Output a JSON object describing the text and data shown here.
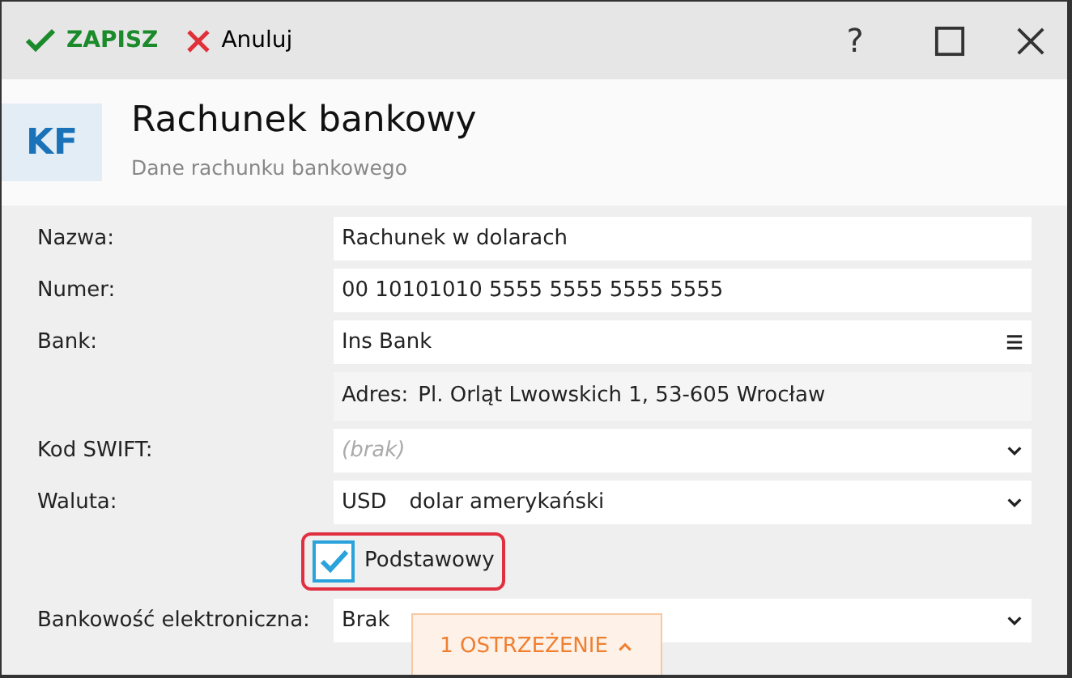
{
  "toolbar": {
    "save": "ZAPISZ",
    "cancel": "Anuluj",
    "help": "?"
  },
  "header": {
    "badge": "KF",
    "title": "Rachunek bankowy",
    "subtitle": "Dane rachunku bankowego"
  },
  "fields": [
    {
      "kind": "text",
      "label": "Nazwa:",
      "value": "Rachunek w dolarach"
    },
    {
      "kind": "text",
      "label": "Numer:",
      "value": "00 10101010 5555 5555 5555 5555"
    },
    {
      "kind": "lookup",
      "label": "Bank:",
      "value": "Ins Bank"
    },
    {
      "kind": "info",
      "prefix": "Adres:",
      "value": "Pl. Orląt Lwowskich 1, 53-605 Wrocław"
    },
    {
      "kind": "select",
      "label": "Kod SWIFT:",
      "placeholder": "(brak)"
    },
    {
      "kind": "select",
      "label": "Waluta:",
      "code": "USD",
      "value": "dolar amerykański"
    },
    {
      "kind": "checkbox",
      "label": "Podstawowy",
      "checked": true,
      "highlighted": true
    },
    {
      "kind": "select",
      "label": "Bankowość elektroniczna:",
      "value": "Brak"
    }
  ],
  "warning": {
    "label": "1 OSTRZEŻENIE",
    "expanded": false
  }
}
